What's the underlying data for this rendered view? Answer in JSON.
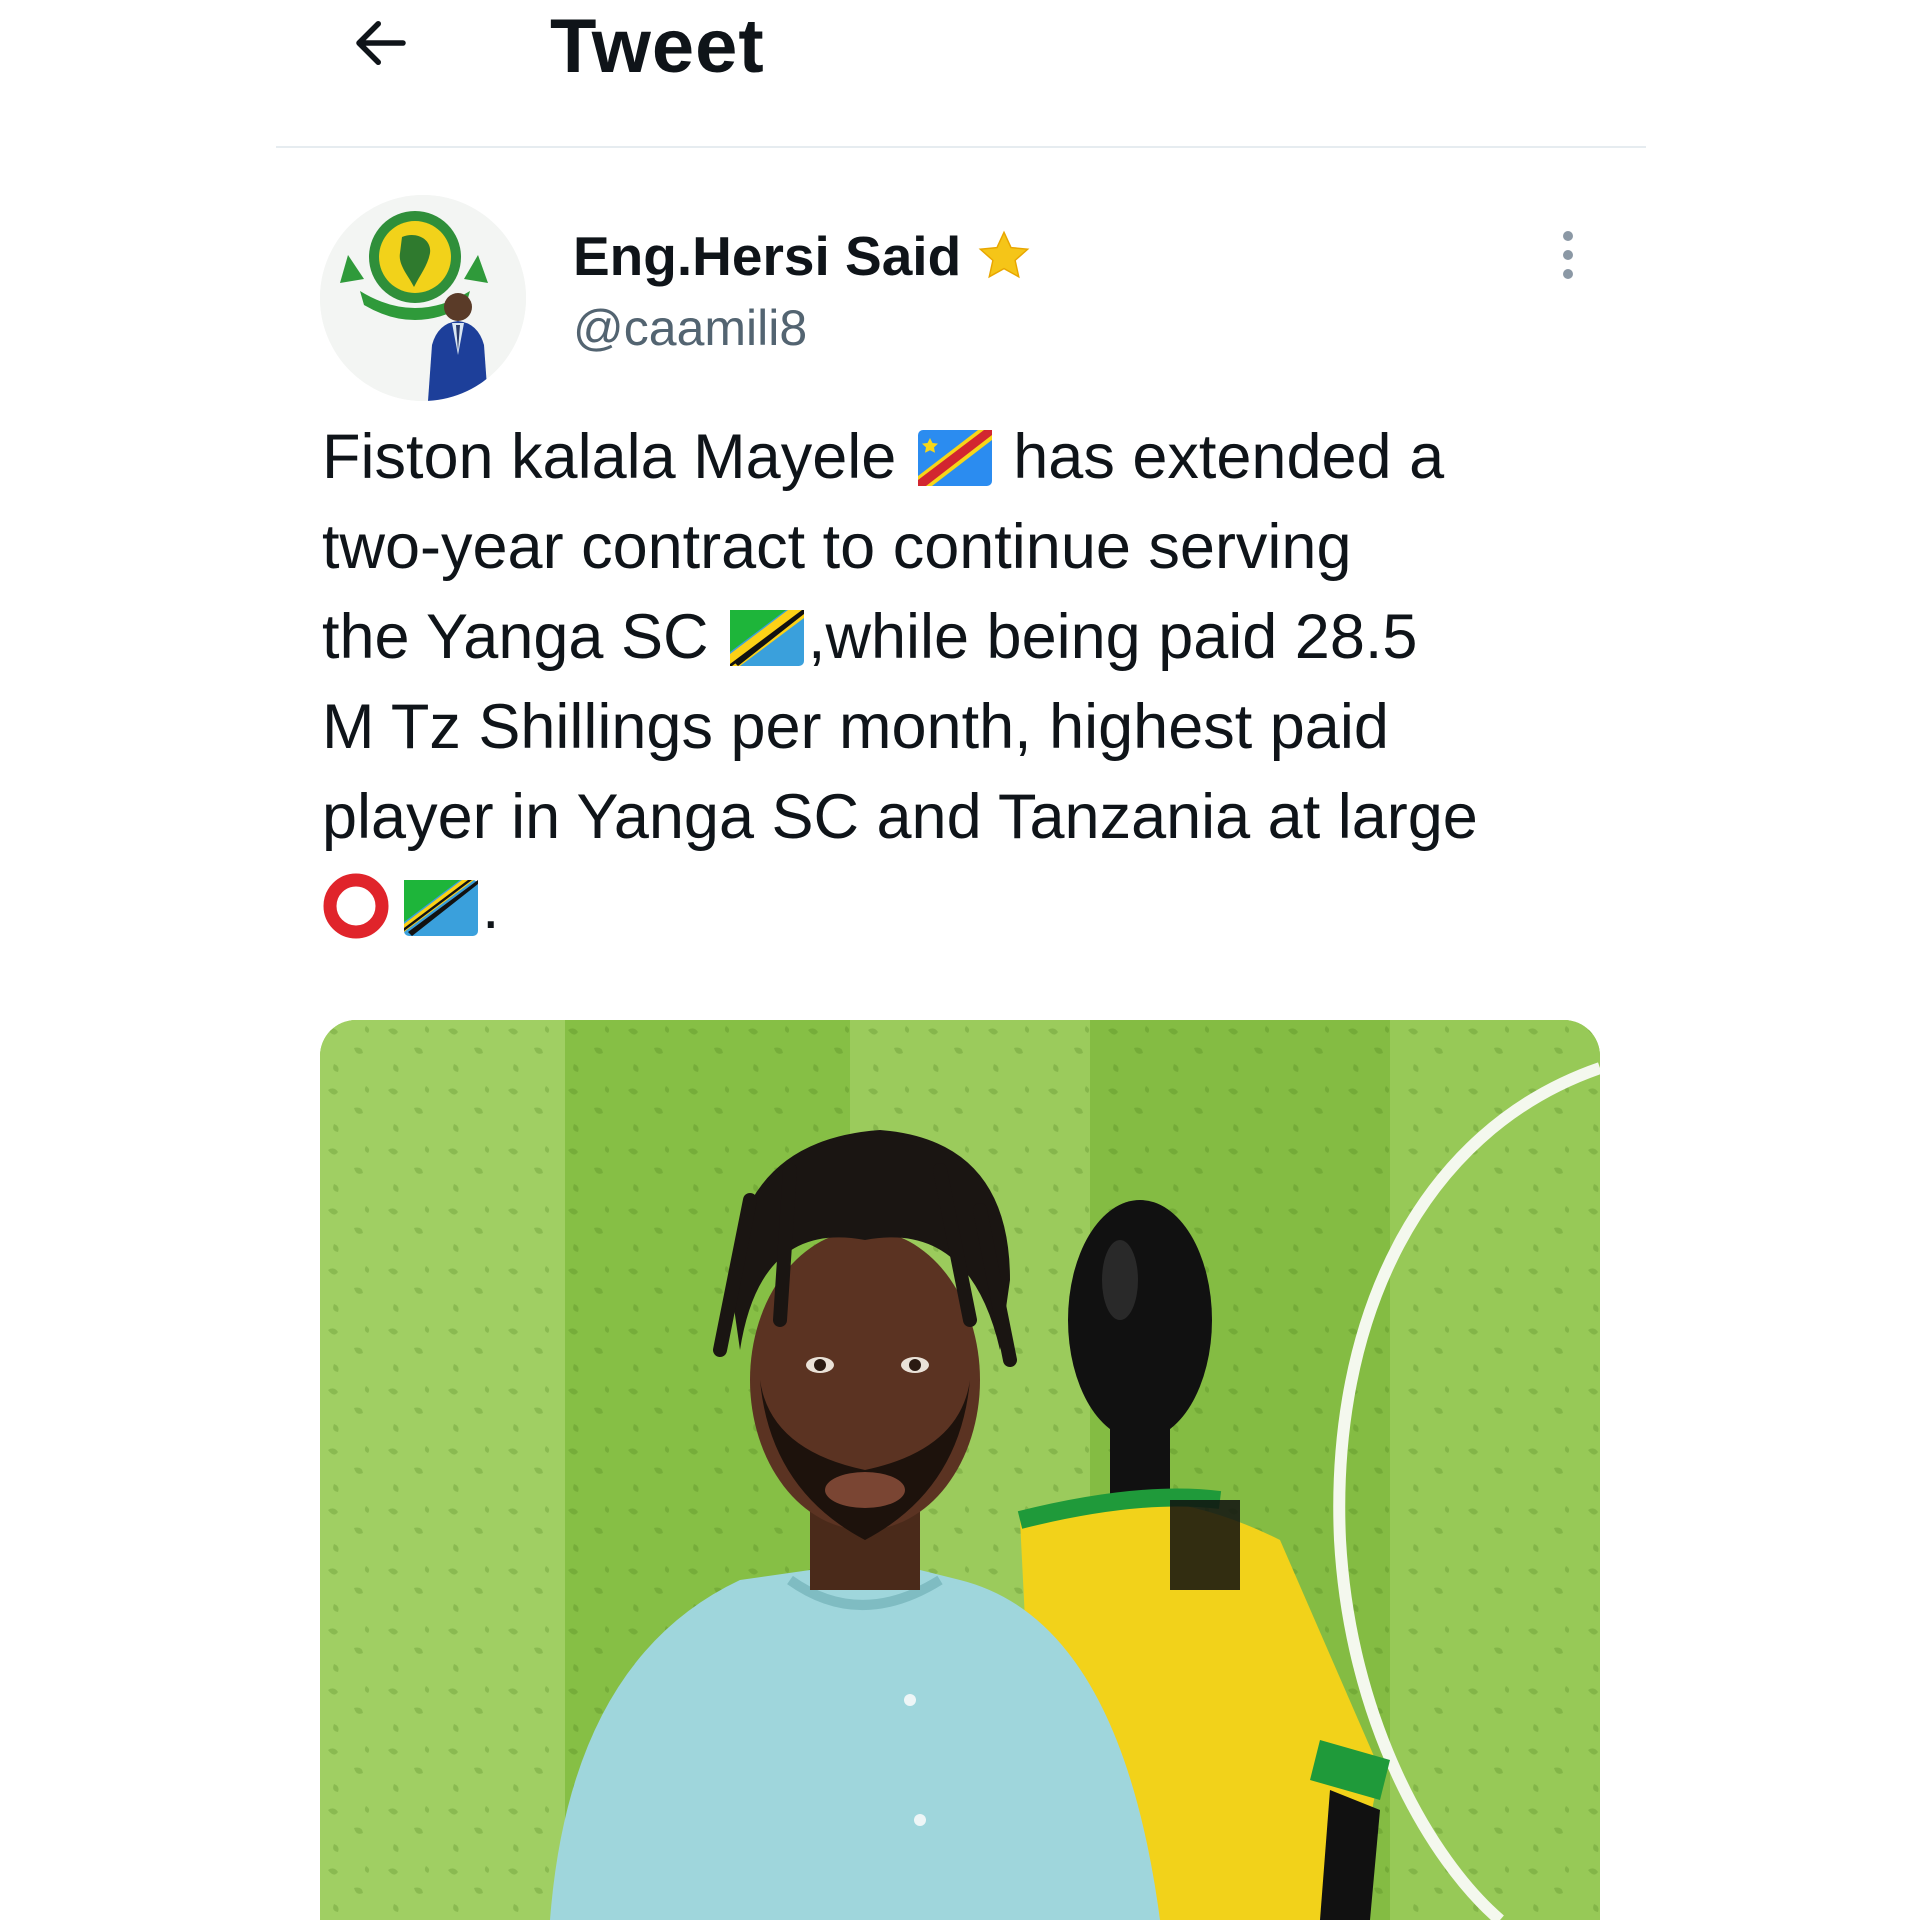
{
  "header": {
    "title": "Tweet",
    "back_icon": "arrow-left-icon"
  },
  "tweet": {
    "author": {
      "display_name": "Eng.Hersi Said",
      "badge_icon": "star-icon",
      "handle": "@caamili8"
    },
    "more_icon": "more-vertical-icon",
    "text_lines": [
      [
        "Fiston kalala Mayele ",
        "flag-cd",
        " has extended a"
      ],
      [
        "two-year contract to continue serving"
      ],
      [
        "the Yanga SC ",
        "flag-tz",
        ",while being paid 28.5"
      ],
      [
        "M Tz Shillings per month,  highest paid"
      ],
      [
        "player in Yanga SC and Tanzania at large"
      ],
      [
        "ring",
        "flag-tz",
        "."
      ]
    ],
    "text": "Fiston kalala Mayele has extended a two-year contract to continue serving the Yanga SC ,while being paid 28.5 M Tz Shillings per month,  highest paid player in Yanga SC and Tanzania at large .",
    "media": {
      "description_icon": "photo"
    }
  },
  "colors": {
    "text_primary": "#0f1419",
    "text_secondary": "#536471",
    "divider": "#e6ecf0",
    "star": "#f5c518",
    "ring_red": "#e0242b"
  }
}
